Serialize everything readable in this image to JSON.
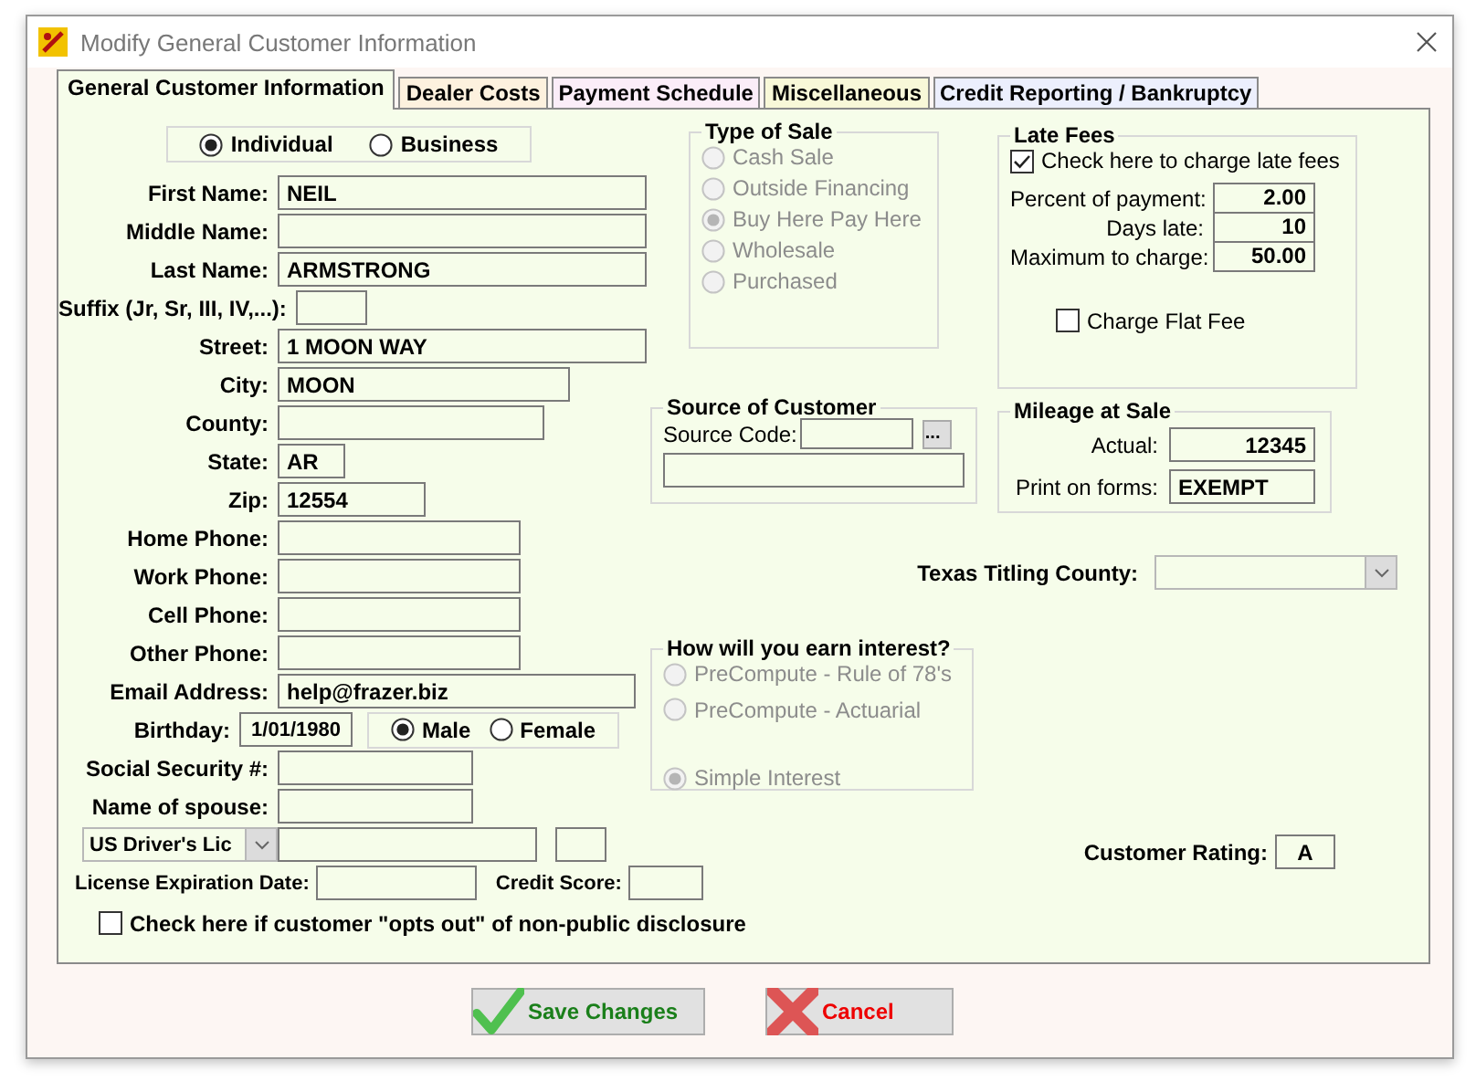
{
  "window": {
    "title": "Modify General Customer Information"
  },
  "tabs": [
    {
      "label": "General Customer Information",
      "selected": true,
      "color": "#f6fdea"
    },
    {
      "label": "Dealer Costs",
      "selected": false,
      "color": "#fdf1de"
    },
    {
      "label": "Payment Schedule",
      "selected": false,
      "color": "#fbedf8"
    },
    {
      "label": "Miscellaneous",
      "selected": false,
      "color": "#f8f8d8"
    },
    {
      "label": "Credit Reporting / Bankruptcy",
      "selected": false,
      "color": "#eceffd"
    }
  ],
  "customer_type": [
    {
      "label": "Individual",
      "selected": true
    },
    {
      "label": "Business",
      "selected": false
    }
  ],
  "fields": [
    {
      "kind": "text",
      "label": "First Name:",
      "value": "NEIL"
    },
    {
      "kind": "text",
      "label": "Middle Name:"
    },
    {
      "kind": "text",
      "label": "Last Name:",
      "value": "ARMSTRONG"
    },
    {
      "kind": "text",
      "label": "Suffix (Jr, Sr, III, IV,...):"
    },
    {
      "kind": "text",
      "label": "Street:",
      "value": "1 MOON WAY"
    },
    {
      "kind": "text",
      "label": "City:",
      "value": "MOON"
    },
    {
      "kind": "text",
      "label": "County:"
    },
    {
      "kind": "text",
      "label": "State:",
      "value": "AR"
    },
    {
      "kind": "text",
      "label": "Zip:",
      "value": "12554"
    },
    {
      "kind": "text",
      "label": "Home Phone:"
    },
    {
      "kind": "text",
      "label": "Work Phone:"
    },
    {
      "kind": "text",
      "label": "Cell Phone:"
    },
    {
      "kind": "text",
      "label": "Other Phone:"
    },
    {
      "kind": "text",
      "label": "Email Address:",
      "value": "help@frazer.biz"
    },
    {
      "kind": "birthday",
      "label": "Birthday:",
      "value": "1/01/1980",
      "options": [
        {
          "label": "Male",
          "selected": true
        },
        {
          "label": "Female",
          "selected": false
        }
      ]
    },
    {
      "kind": "text",
      "label": "Social Security #:"
    },
    {
      "kind": "text",
      "label": "Name of spouse:"
    },
    {
      "kind": "license",
      "combo": "US Driver's Lic"
    },
    {
      "kind": "pair",
      "label": "License Expiration Date:",
      "label_2": "Credit Score:"
    },
    {
      "kind": "checkbox",
      "label": "Check here if customer \"opts out\" of non-public disclosure",
      "checked": false
    }
  ],
  "type_of_sale": {
    "title": "Type of Sale",
    "disabled": true,
    "options": [
      {
        "label": "Cash Sale",
        "selected": false
      },
      {
        "label": "Outside Financing",
        "selected": false
      },
      {
        "label": "Buy Here Pay Here",
        "selected": true
      },
      {
        "label": "Wholesale",
        "selected": false
      },
      {
        "label": "Purchased",
        "selected": false
      }
    ]
  },
  "late_fees": {
    "title": "Late Fees",
    "charge": {
      "label": "Check here to charge late fees",
      "checked": true
    },
    "rows": [
      {
        "label": "Percent of payment:",
        "value": "2.00"
      },
      {
        "label": "Days late:",
        "value": "10"
      },
      {
        "label": "Maximum to charge:",
        "value": "50.00"
      }
    ],
    "flat_fee": {
      "label": "Charge Flat Fee",
      "checked": false
    }
  },
  "source_of_customer": {
    "title": "Source of Customer",
    "label": "Source Code:",
    "button": "..."
  },
  "mileage": {
    "title": "Mileage at Sale",
    "rows": [
      {
        "kind": "number",
        "label": "Actual:",
        "value": "12345"
      },
      {
        "kind": "text",
        "label": "Print on forms:",
        "value": "EXEMPT"
      }
    ]
  },
  "titling_county": {
    "label": "Texas Titling County:"
  },
  "interest": {
    "title": "How will you earn interest?",
    "disabled": true,
    "options": [
      {
        "label": "PreCompute - Rule of 78's",
        "selected": false
      },
      {
        "label": "PreCompute - Actuarial",
        "selected": false
      },
      {
        "label": "Simple Interest",
        "selected": true
      }
    ]
  },
  "customer_rating": {
    "label": "Customer Rating:",
    "value": "A"
  },
  "buttons": [
    {
      "kind": "save",
      "label": "Save Changes"
    },
    {
      "kind": "cancel",
      "label": "Cancel"
    }
  ]
}
